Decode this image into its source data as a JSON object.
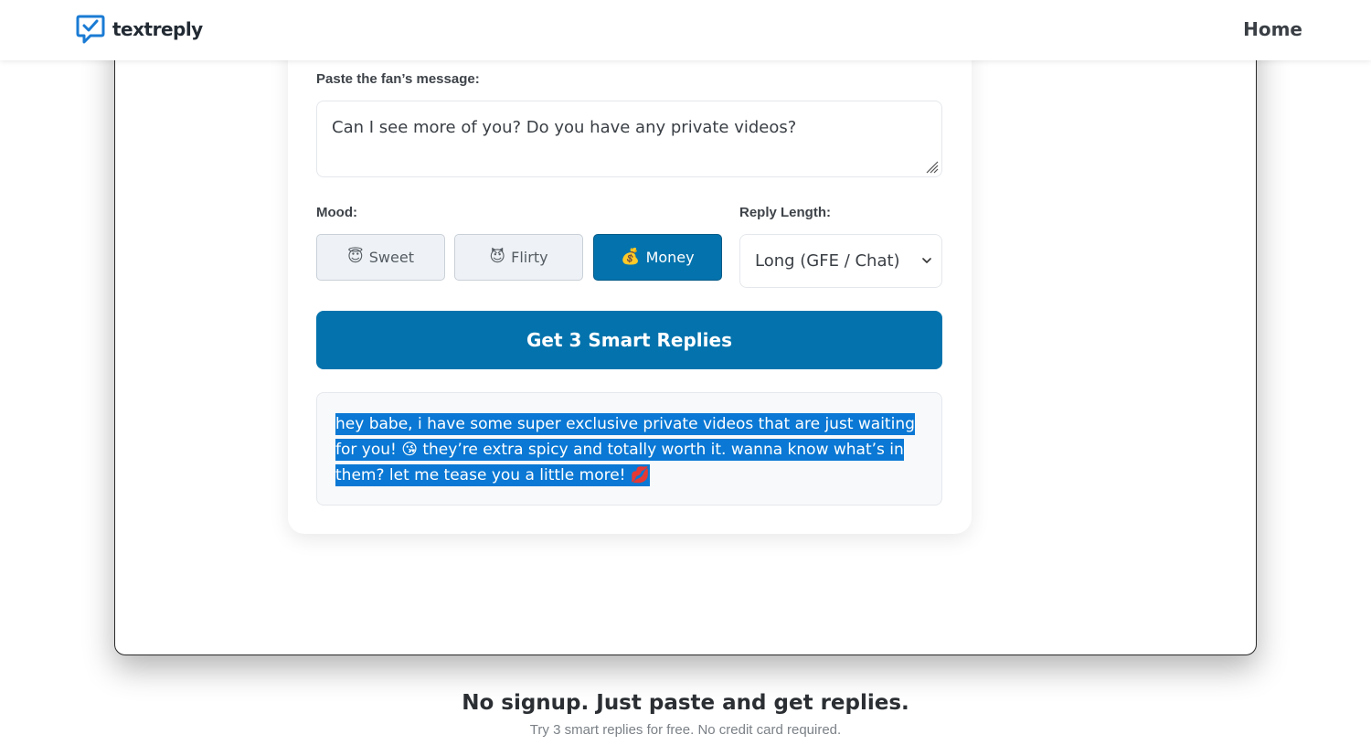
{
  "header": {
    "brand": "textreply",
    "nav_home": "Home"
  },
  "form": {
    "message_label": "Paste the fan’s message:",
    "message_value": "Can I see more of you? Do you have any private videos?",
    "mood_label": "Mood:",
    "moods": [
      {
        "emoji": "😇",
        "label": "Sweet",
        "active": false
      },
      {
        "emoji": "😈",
        "label": "Flirty",
        "active": false
      },
      {
        "emoji": "💰",
        "label": "Money",
        "active": true
      }
    ],
    "length_label": "Reply Length:",
    "length_selected": "Long (GFE / Chat)",
    "submit_label": "Get 3 Smart Replies"
  },
  "result": {
    "reply_text": "hey babe, i have some super exclusive private videos that are just waiting for you! 😘 they’re extra spicy and totally worth it. wanna know what’s in them? let me tease you a little more! 💋"
  },
  "footer": {
    "title": "No signup. Just paste and get replies.",
    "subtitle": "Try 3 smart replies for free. No credit card required."
  },
  "colors": {
    "accent": "#0473ad",
    "selection": "#0a78d4",
    "logo_blue": "#1a7bd4"
  },
  "icons": {
    "logo": "chat-check-icon",
    "select_arrow": "chevron-down-icon",
    "resize": "resize-grip-icon"
  }
}
